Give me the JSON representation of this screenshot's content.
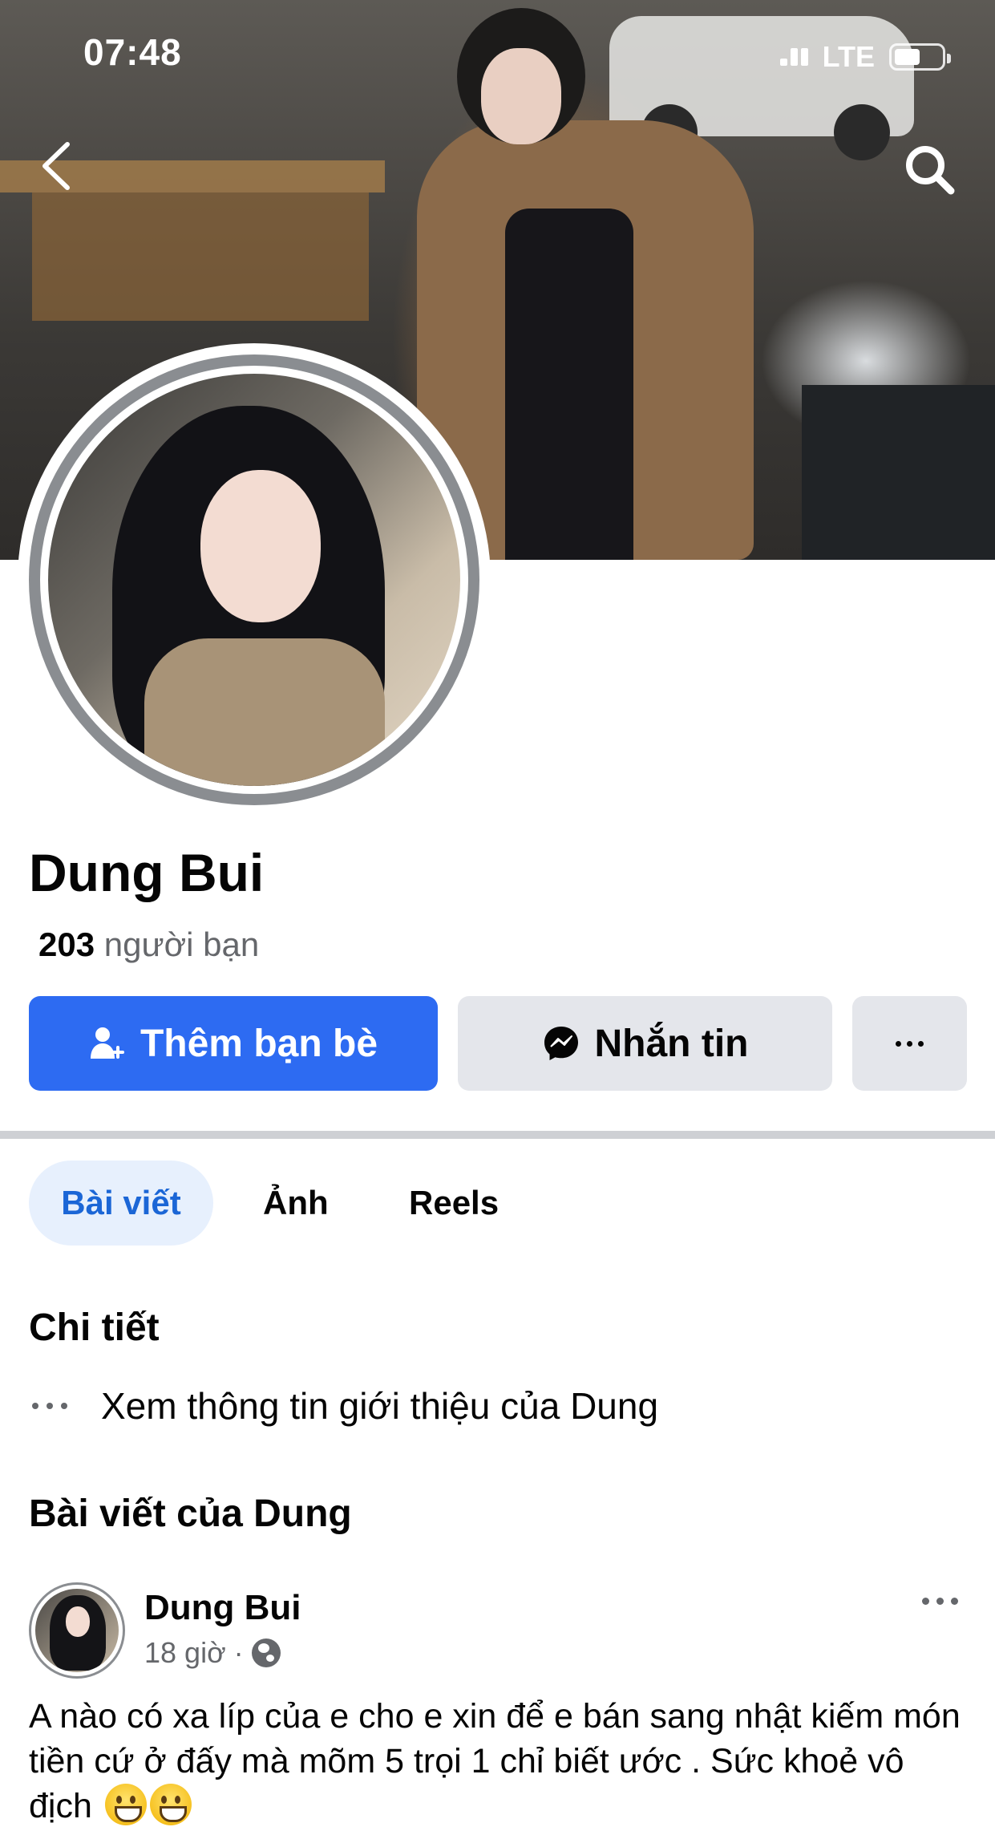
{
  "status_bar": {
    "time": "07:48",
    "network": "LTE",
    "battery_level": 0.55
  },
  "header": {
    "back_icon": "chevron-left-icon",
    "search_icon": "search-icon"
  },
  "profile": {
    "name": "Dung Bui",
    "friends_count": "203",
    "friends_label": "người bạn"
  },
  "actions": {
    "add_friend_label": "Thêm bạn bè",
    "add_friend_icon": "add-person-icon",
    "message_label": "Nhắn tin",
    "message_icon": "messenger-icon",
    "more_icon": "more-horizontal-icon"
  },
  "tabs": [
    {
      "label": "Bài viết",
      "active": true
    },
    {
      "label": "Ảnh",
      "active": false
    },
    {
      "label": "Reels",
      "active": false
    }
  ],
  "details": {
    "title": "Chi tiết",
    "intro_link": "Xem thông tin giới thiệu của Dung"
  },
  "posts_section": {
    "title": "Bài viết của Dung"
  },
  "post": {
    "author": "Dung Bui",
    "time": "18 giờ",
    "separator": "·",
    "privacy_icon": "globe-icon",
    "text": "A nào có xa líp của e cho e xin để e bán sang nhật kiếm món tiền  cứ ở đấy mà mõm 5 trọi 1 chỉ biết ước . Sức khoẻ vô địch",
    "emojis": [
      "grinning-face",
      "grinning-face"
    ]
  },
  "colors": {
    "accent": "#2d6bf2",
    "tab_active_bg": "#e7f0fd",
    "tab_active_text": "#1b66d6",
    "secondary_button": "#e4e6eb",
    "muted_text": "#65676b"
  }
}
